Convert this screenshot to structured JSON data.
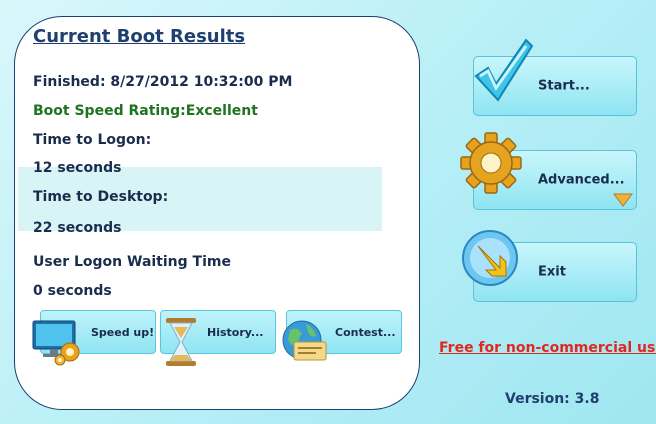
{
  "results": {
    "title": "Current Boot Results",
    "finished": "Finished: 8/27/2012 10:32:00 PM",
    "rating": "Boot Speed Rating:Excellent",
    "logon_label": "Time to Logon:",
    "logon_value": "12 seconds",
    "desktop_label": "Time to Desktop:",
    "desktop_value": "22 seconds",
    "waiting_label": "User Logon Waiting Time",
    "waiting_value": "0 seconds"
  },
  "bottom_buttons": {
    "speedup": "Speed up!",
    "history": "History...",
    "contest": "Contest..."
  },
  "side_buttons": {
    "start": "Start...",
    "advanced": "Advanced...",
    "exit": "Exit"
  },
  "footer": {
    "free_link": "Free for non-commercial use",
    "version": "Version: 3.8"
  },
  "colors": {
    "rating_green": "#207320",
    "link_red": "#e0281e",
    "title_blue": "#1f3f6e"
  },
  "icons": [
    "checkmark-icon",
    "gear-icon",
    "exit-arrow-icon",
    "monitor-gear-icon",
    "hourglass-icon",
    "globe-icon",
    "dropdown-arrow-icon"
  ]
}
